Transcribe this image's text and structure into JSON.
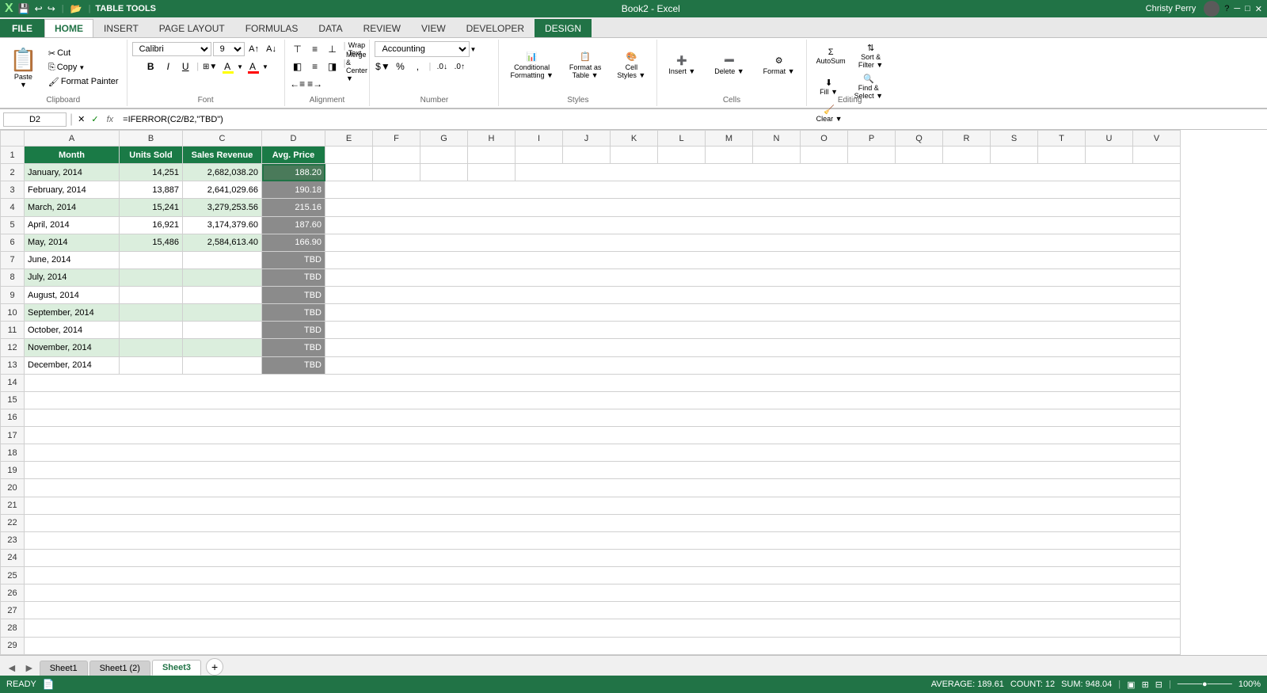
{
  "titlebar": {
    "app_icon": "X",
    "title": "Book2 - Excel",
    "table_tools": "TABLE TOOLS",
    "user_name": "Christy Perry",
    "quick_access": [
      "save",
      "undo",
      "redo",
      "open"
    ]
  },
  "ribbon_tabs": [
    {
      "id": "file",
      "label": "FILE",
      "type": "file"
    },
    {
      "id": "home",
      "label": "HOME",
      "type": "active"
    },
    {
      "id": "insert",
      "label": "INSERT"
    },
    {
      "id": "page_layout",
      "label": "PAGE LAYOUT"
    },
    {
      "id": "formulas",
      "label": "FORMULAS"
    },
    {
      "id": "data",
      "label": "DATA"
    },
    {
      "id": "review",
      "label": "REVIEW"
    },
    {
      "id": "view",
      "label": "VIEW"
    },
    {
      "id": "developer",
      "label": "DEVELOPER"
    },
    {
      "id": "design",
      "label": "DESIGN",
      "type": "design"
    }
  ],
  "ribbon": {
    "clipboard": {
      "label": "Clipboard",
      "paste": "Paste",
      "cut": "Cut",
      "copy": "Copy",
      "format_painter": "Format Painter"
    },
    "font": {
      "label": "Font",
      "font_name": "Calibri",
      "font_size": "9",
      "bold": "B",
      "italic": "I",
      "underline": "U"
    },
    "alignment": {
      "label": "Alignment",
      "wrap_text": "Wrap Text",
      "merge_center": "Merge & Center"
    },
    "number": {
      "label": "Number",
      "format": "Accounting",
      "dollar": "$",
      "percent": "%",
      "comma": ","
    },
    "styles": {
      "label": "Styles",
      "conditional": "Conditional Formatting",
      "format_table": "Format as Table",
      "cell_styles": "Cell Styles"
    },
    "cells": {
      "label": "Cells",
      "insert": "Insert",
      "delete": "Delete",
      "format": "Format"
    },
    "editing": {
      "label": "Editing",
      "autosum": "AutoSum",
      "fill": "Fill",
      "clear": "Clear",
      "sort_filter": "Sort & Filter",
      "find_select": "Find & Select"
    }
  },
  "formula_bar": {
    "cell_ref": "D2",
    "formula": "=IFERROR(C2/B2,\"TBD\")"
  },
  "columns": [
    "",
    "A",
    "B",
    "C",
    "D",
    "E",
    "F",
    "G",
    "H",
    "I",
    "J",
    "K",
    "L",
    "M",
    "N",
    "O",
    "P",
    "Q",
    "R",
    "S",
    "T",
    "U",
    "V"
  ],
  "table_data": {
    "headers": [
      "Month",
      "Units Sold",
      "Sales Revenue",
      "Avg. Price"
    ],
    "rows": [
      [
        "January, 2014",
        "14,251",
        "2,682,038.20",
        "188.20"
      ],
      [
        "February, 2014",
        "13,887",
        "2,641,029.66",
        "190.18"
      ],
      [
        "March, 2014",
        "15,241",
        "3,279,253.56",
        "215.16"
      ],
      [
        "April, 2014",
        "16,921",
        "3,174,379.60",
        "187.60"
      ],
      [
        "May, 2014",
        "15,486",
        "2,584,613.40",
        "166.90"
      ],
      [
        "June, 2014",
        "",
        "",
        "TBD"
      ],
      [
        "July, 2014",
        "",
        "",
        "TBD"
      ],
      [
        "August, 2014",
        "",
        "",
        "TBD"
      ],
      [
        "September, 2014",
        "",
        "",
        "TBD"
      ],
      [
        "October, 2014",
        "",
        "",
        "TBD"
      ],
      [
        "November, 2014",
        "",
        "",
        "TBD"
      ],
      [
        "December, 2014",
        "",
        "",
        "TBD"
      ]
    ]
  },
  "sheet_tabs": [
    {
      "label": "Sheet1",
      "active": false
    },
    {
      "label": "Sheet1 (2)",
      "active": false
    },
    {
      "label": "Sheet3",
      "active": true
    }
  ],
  "status_bar": {
    "ready": "READY",
    "average": "AVERAGE: 189.61",
    "count": "COUNT: 12",
    "sum": "SUM: 948.04",
    "zoom": "100%"
  }
}
